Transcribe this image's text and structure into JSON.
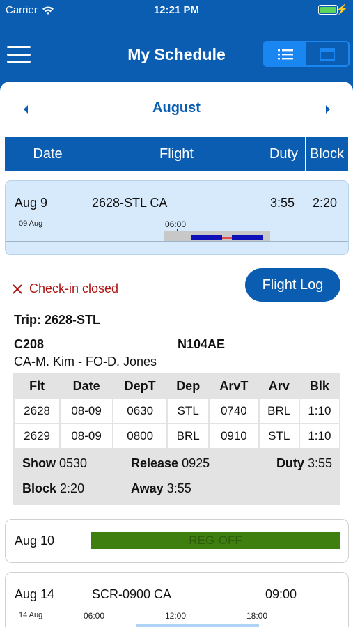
{
  "status_bar": {
    "carrier": "Carrier",
    "time": "12:21 PM"
  },
  "header": {
    "title": "My Schedule",
    "view_toggle": [
      "list-view",
      "calendar-view"
    ]
  },
  "month": {
    "label": "August"
  },
  "columns": [
    "Date",
    "Flight",
    "Duty",
    "Block"
  ],
  "selected_day": {
    "date": "Aug 9",
    "flight": "2628-STL CA",
    "duty": "3:55",
    "block": "2:20",
    "timeline_date": "09 Aug",
    "timeline_tick": "06:00"
  },
  "detail": {
    "checkin_status": "Check-in closed",
    "flight_log_label": "Flight Log",
    "trip": "Trip: 2628-STL",
    "aircraft": "C208",
    "tail": "N104AE",
    "crew": "CA-M. Kim - FO-D. Jones",
    "leg_headers": [
      "Flt",
      "Date",
      "DepT",
      "Dep",
      "ArvT",
      "Arv",
      "Blk"
    ],
    "legs": [
      [
        "2628",
        "08-09",
        "0630",
        "STL",
        "0740",
        "BRL",
        "1:10"
      ],
      [
        "2629",
        "08-09",
        "0800",
        "BRL",
        "0910",
        "STL",
        "1:10"
      ]
    ],
    "summary": {
      "show_label": "Show",
      "show": "0530",
      "release_label": "Release",
      "release": "0925",
      "duty_label": "Duty",
      "duty": "3:55",
      "block_label": "Block",
      "block": "2:20",
      "away_label": "Away",
      "away": "3:55"
    }
  },
  "off_day": {
    "date": "Aug 10",
    "label": "REG-OFF",
    "color": "#3f7f10"
  },
  "next_day": {
    "date": "Aug 14",
    "flight": "SCR-0900 CA",
    "time": "09:00",
    "timeline_date": "14 Aug",
    "ticks": [
      "06:00",
      "12:00",
      "18:00"
    ]
  },
  "colors": {
    "primary": "#0a5db1",
    "accent": "#1a86f2",
    "selected_bg": "#d7eafb",
    "alert": "#b01515"
  }
}
